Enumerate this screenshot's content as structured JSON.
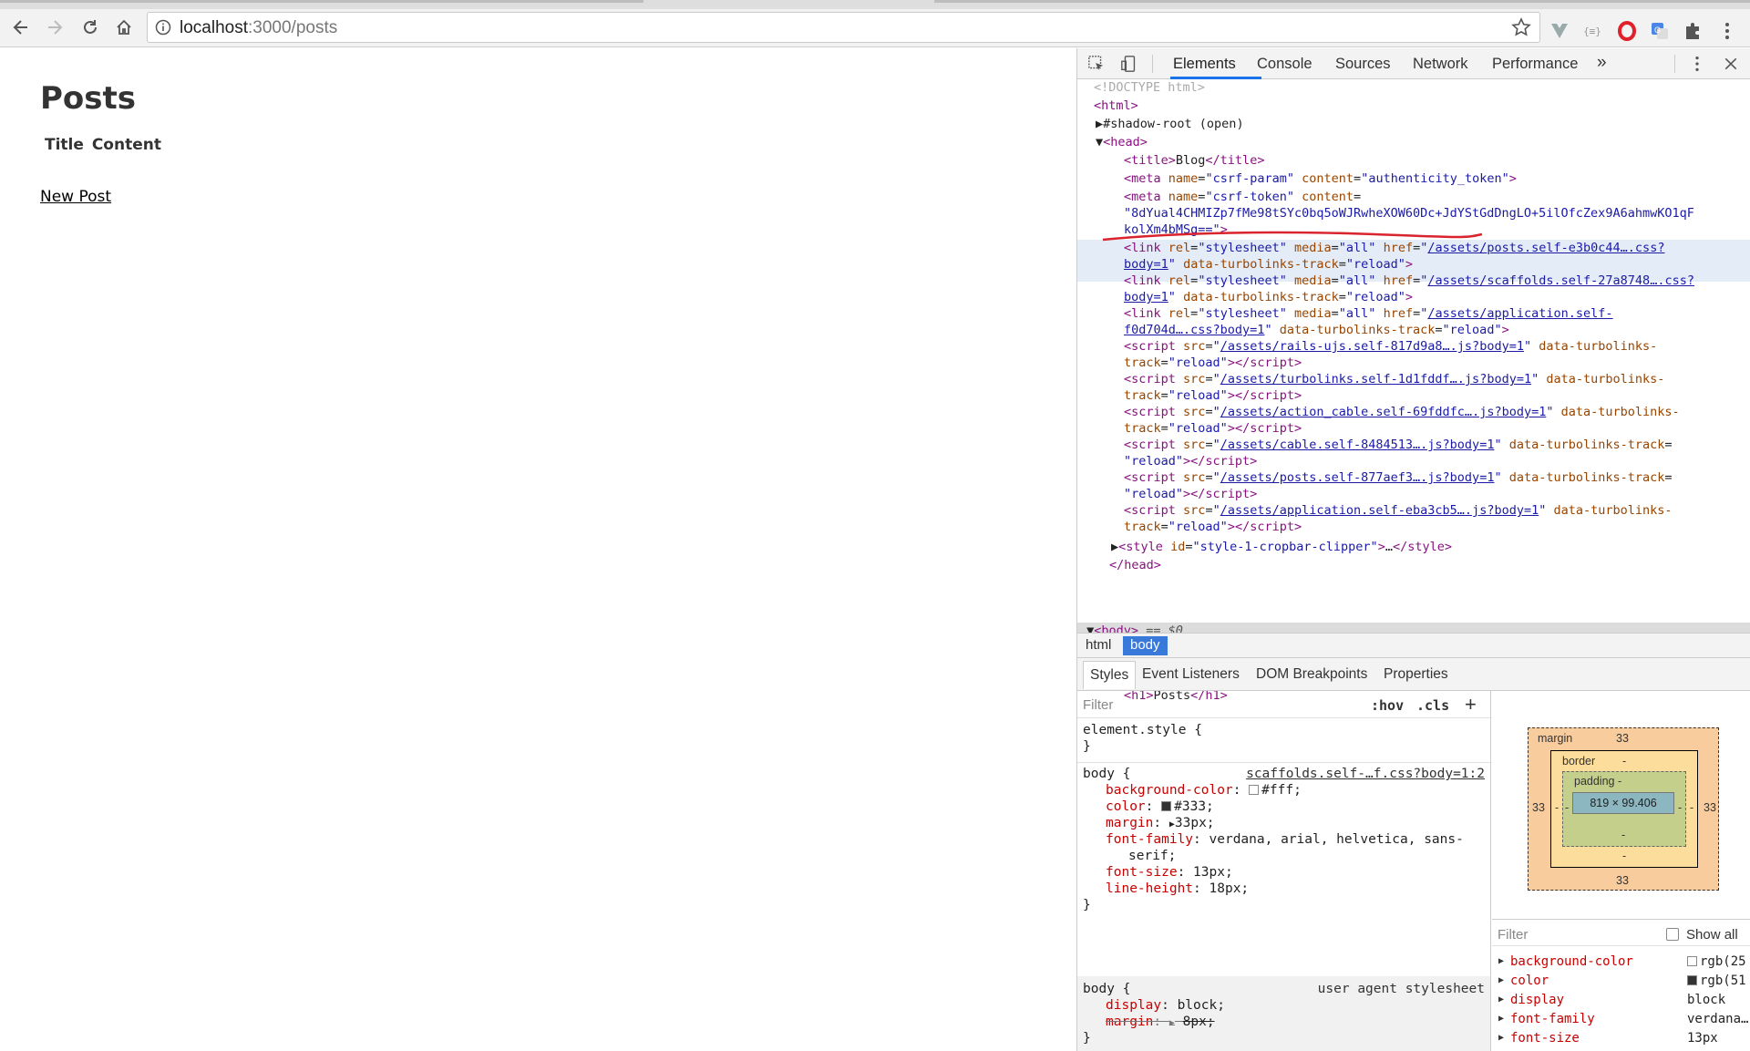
{
  "browser": {
    "url_host": "localhost",
    "url_path": ":3000/posts",
    "extensions": [
      "vue-devtools-icon",
      "json-viewer-icon",
      "opera-icon",
      "translate-icon",
      "extension-icon"
    ]
  },
  "page": {
    "heading": "Posts",
    "table_headers": "Title Content",
    "new_post_link": "New Post"
  },
  "devtools": {
    "tabs": [
      "Elements",
      "Console",
      "Sources",
      "Network",
      "Performance",
      "»"
    ],
    "active_tab": "Elements",
    "dom_lines": [
      {
        "doctype": "<!DOCTYPE html>"
      },
      {
        "open": "html"
      },
      {
        "shadow": "#shadow-root (open)"
      },
      {
        "open": "head"
      },
      {
        "title_text": "Blog"
      },
      {
        "meta1_name": "csrf-param",
        "meta1_content": "authenticity_token"
      },
      {
        "meta2_name": "csrf-token",
        "meta2_content_1": "8dYual4CHMIZp7fMe98tSYc0bq5oWJRwheXOW60Dc+JdYStGdDngLO+5ilOfcZex9A6ahmwKO1qF",
        "meta2_content_2": "kolXm4bMSg=="
      }
    ],
    "links": [
      {
        "href_1": "/assets/posts.self-e3b0c44….css?",
        "href_2": "body=1"
      },
      {
        "href_1": "/assets/scaffolds.self-27a8748….css?",
        "href_2": "body=1"
      },
      {
        "href_1": "/assets/application.self-",
        "href_2": "f0d704d….css?body=1"
      }
    ],
    "scripts": [
      "/assets/rails-ujs.self-817d9a8….js?body=1",
      "/assets/turbolinks.self-1d1fddf….js?body=1",
      "/assets/action_cable.self-69fddfc….js?body=1",
      "/assets/cable.self-8484513….js?body=1",
      "/assets/posts.self-877aef3….js?body=1",
      "/assets/application.self-eba3cb5….js?body=1"
    ],
    "style_id": "style-1-cropbar-clipper",
    "body_marker": "== $0",
    "p_id": "notice",
    "h1_text": "Posts",
    "breadcrumbs": [
      "html",
      "body"
    ],
    "sub_tabs": [
      "Styles",
      "Event Listeners",
      "DOM Breakpoints",
      "Properties"
    ],
    "styles": {
      "filter_placeholder": "Filter",
      "hov": ":hov",
      "cls": ".cls",
      "element_style": "element.style {",
      "rule1_selector": "body {",
      "rule1_source": "scaffolds.self-…f.css?body=1:2",
      "rule1_props": [
        {
          "name": "background-color",
          "value": "#fff;",
          "swatch": "#ffffff"
        },
        {
          "name": "color",
          "value": "#333;",
          "swatch": "#333333"
        },
        {
          "name": "margin",
          "value": "33px;"
        },
        {
          "name": "font-family",
          "value": "verdana, arial, helvetica, sans-"
        },
        {
          "name": "font-size",
          "value": "13px;"
        },
        {
          "name": "line-height",
          "value": "18px;"
        }
      ],
      "font_family_cont": "serif;",
      "rule2_selector": "body {",
      "rule2_source": "user agent stylesheet",
      "rule2_props": [
        {
          "name": "display",
          "value": "block;"
        },
        {
          "name": "margin",
          "value": "8px;"
        }
      ]
    },
    "box_model": {
      "margin_label": "margin",
      "margin_top": "33",
      "margin_bottom": "33",
      "margin_left": "33",
      "margin_right": "33",
      "border_label": "border",
      "border_value": "-",
      "padding_label": "padding -",
      "content_size": "819 × 99.406",
      "dash": "-"
    },
    "computed": {
      "filter_placeholder": "Filter",
      "show_all": "Show all",
      "props": [
        {
          "name": "background-color",
          "value": "rgb(25",
          "swatch": "#ffffff"
        },
        {
          "name": "color",
          "value": "rgb(51",
          "swatch": "#333333"
        },
        {
          "name": "display",
          "value": "block"
        },
        {
          "name": "font-family",
          "value": "verdana…"
        },
        {
          "name": "font-size",
          "value": "13px"
        }
      ]
    }
  }
}
